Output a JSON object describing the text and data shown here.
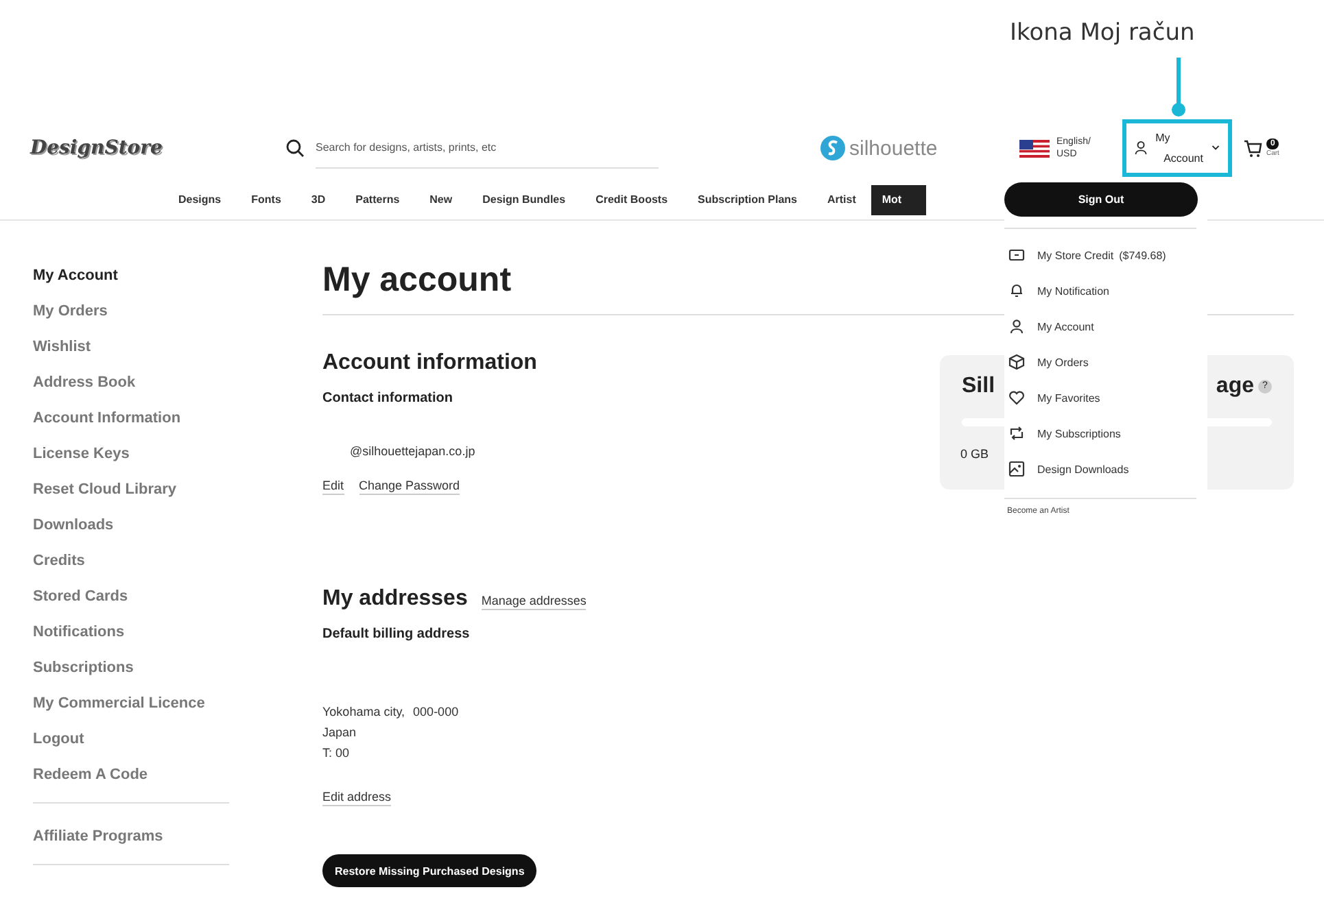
{
  "annotation": {
    "label": "Ikona Moj račun"
  },
  "header": {
    "logo": "DesignStore",
    "search": {
      "placeholder": "Search for designs, artists, prints, etc"
    },
    "brand": "silhouette",
    "language": "English/",
    "currency": "USD",
    "account": {
      "line_1": "My",
      "line_2": "Account",
      "highlighted": true
    },
    "cart": {
      "count": "0",
      "label": "Cart"
    }
  },
  "nav": [
    {
      "label": "Designs",
      "selected": false
    },
    {
      "label": "Fonts",
      "selected": false
    },
    {
      "label": "3D",
      "selected": false
    },
    {
      "label": "Patterns",
      "selected": false
    },
    {
      "label": "New",
      "selected": false
    },
    {
      "label": "Design Bundles",
      "selected": false
    },
    {
      "label": "Credit Boosts",
      "selected": false
    },
    {
      "label": "Subscription Plans",
      "selected": false
    },
    {
      "label": "Artist",
      "selected": false
    },
    {
      "label": "Mot",
      "selected": true
    }
  ],
  "account_menu": {
    "sign_out": "Sign Out",
    "items": [
      {
        "label": "My Store Credit",
        "extra": "($749.68)"
      },
      {
        "label": "My Notification"
      },
      {
        "label": "My Account"
      },
      {
        "label": "My Orders"
      },
      {
        "label": "My Favorites"
      },
      {
        "label": "My Subscriptions"
      },
      {
        "label": "Design Downloads"
      }
    ],
    "footer": "Become an Artist"
  },
  "sidebar": {
    "items": [
      {
        "label": "My Account",
        "selected": true
      },
      {
        "label": "My Orders",
        "selected": false
      },
      {
        "label": "Wishlist",
        "selected": false
      },
      {
        "label": "Address Book",
        "selected": false
      },
      {
        "label": "Account Information",
        "selected": false
      },
      {
        "label": "License Keys",
        "selected": false
      },
      {
        "label": "Reset Cloud Library",
        "selected": false
      },
      {
        "label": "Downloads",
        "selected": false
      },
      {
        "label": "Credits",
        "selected": false
      },
      {
        "label": "Stored Cards",
        "selected": false
      },
      {
        "label": "Notifications",
        "selected": false
      },
      {
        "label": "Subscriptions",
        "selected": false
      },
      {
        "label": "My Commercial Licence",
        "selected": false
      },
      {
        "label": "Logout",
        "selected": false
      },
      {
        "label": "Redeem A Code",
        "selected": false
      }
    ],
    "extra_items": [
      {
        "label": "Affiliate Programs",
        "selected": false
      }
    ]
  },
  "main": {
    "title": "My account",
    "account_info": {
      "heading": "Account information",
      "subheading": "Contact information",
      "email": "@silhouettejapan.co.jp",
      "links": [
        "Edit",
        "Change Password"
      ]
    },
    "storage": {
      "title_start": "Sill",
      "title_end": "age",
      "help": "?",
      "level": 0,
      "reading": "0 GB"
    },
    "addresses": {
      "heading": "My addresses",
      "manage_link": "Manage addresses",
      "subheading": "Default billing address",
      "city": "Yokohama city,",
      "postcode": "000-000",
      "country": "Japan",
      "phone": "T: 00",
      "edit_link": "Edit address"
    },
    "restore_button": "Restore Missing Purchased Designs"
  }
}
